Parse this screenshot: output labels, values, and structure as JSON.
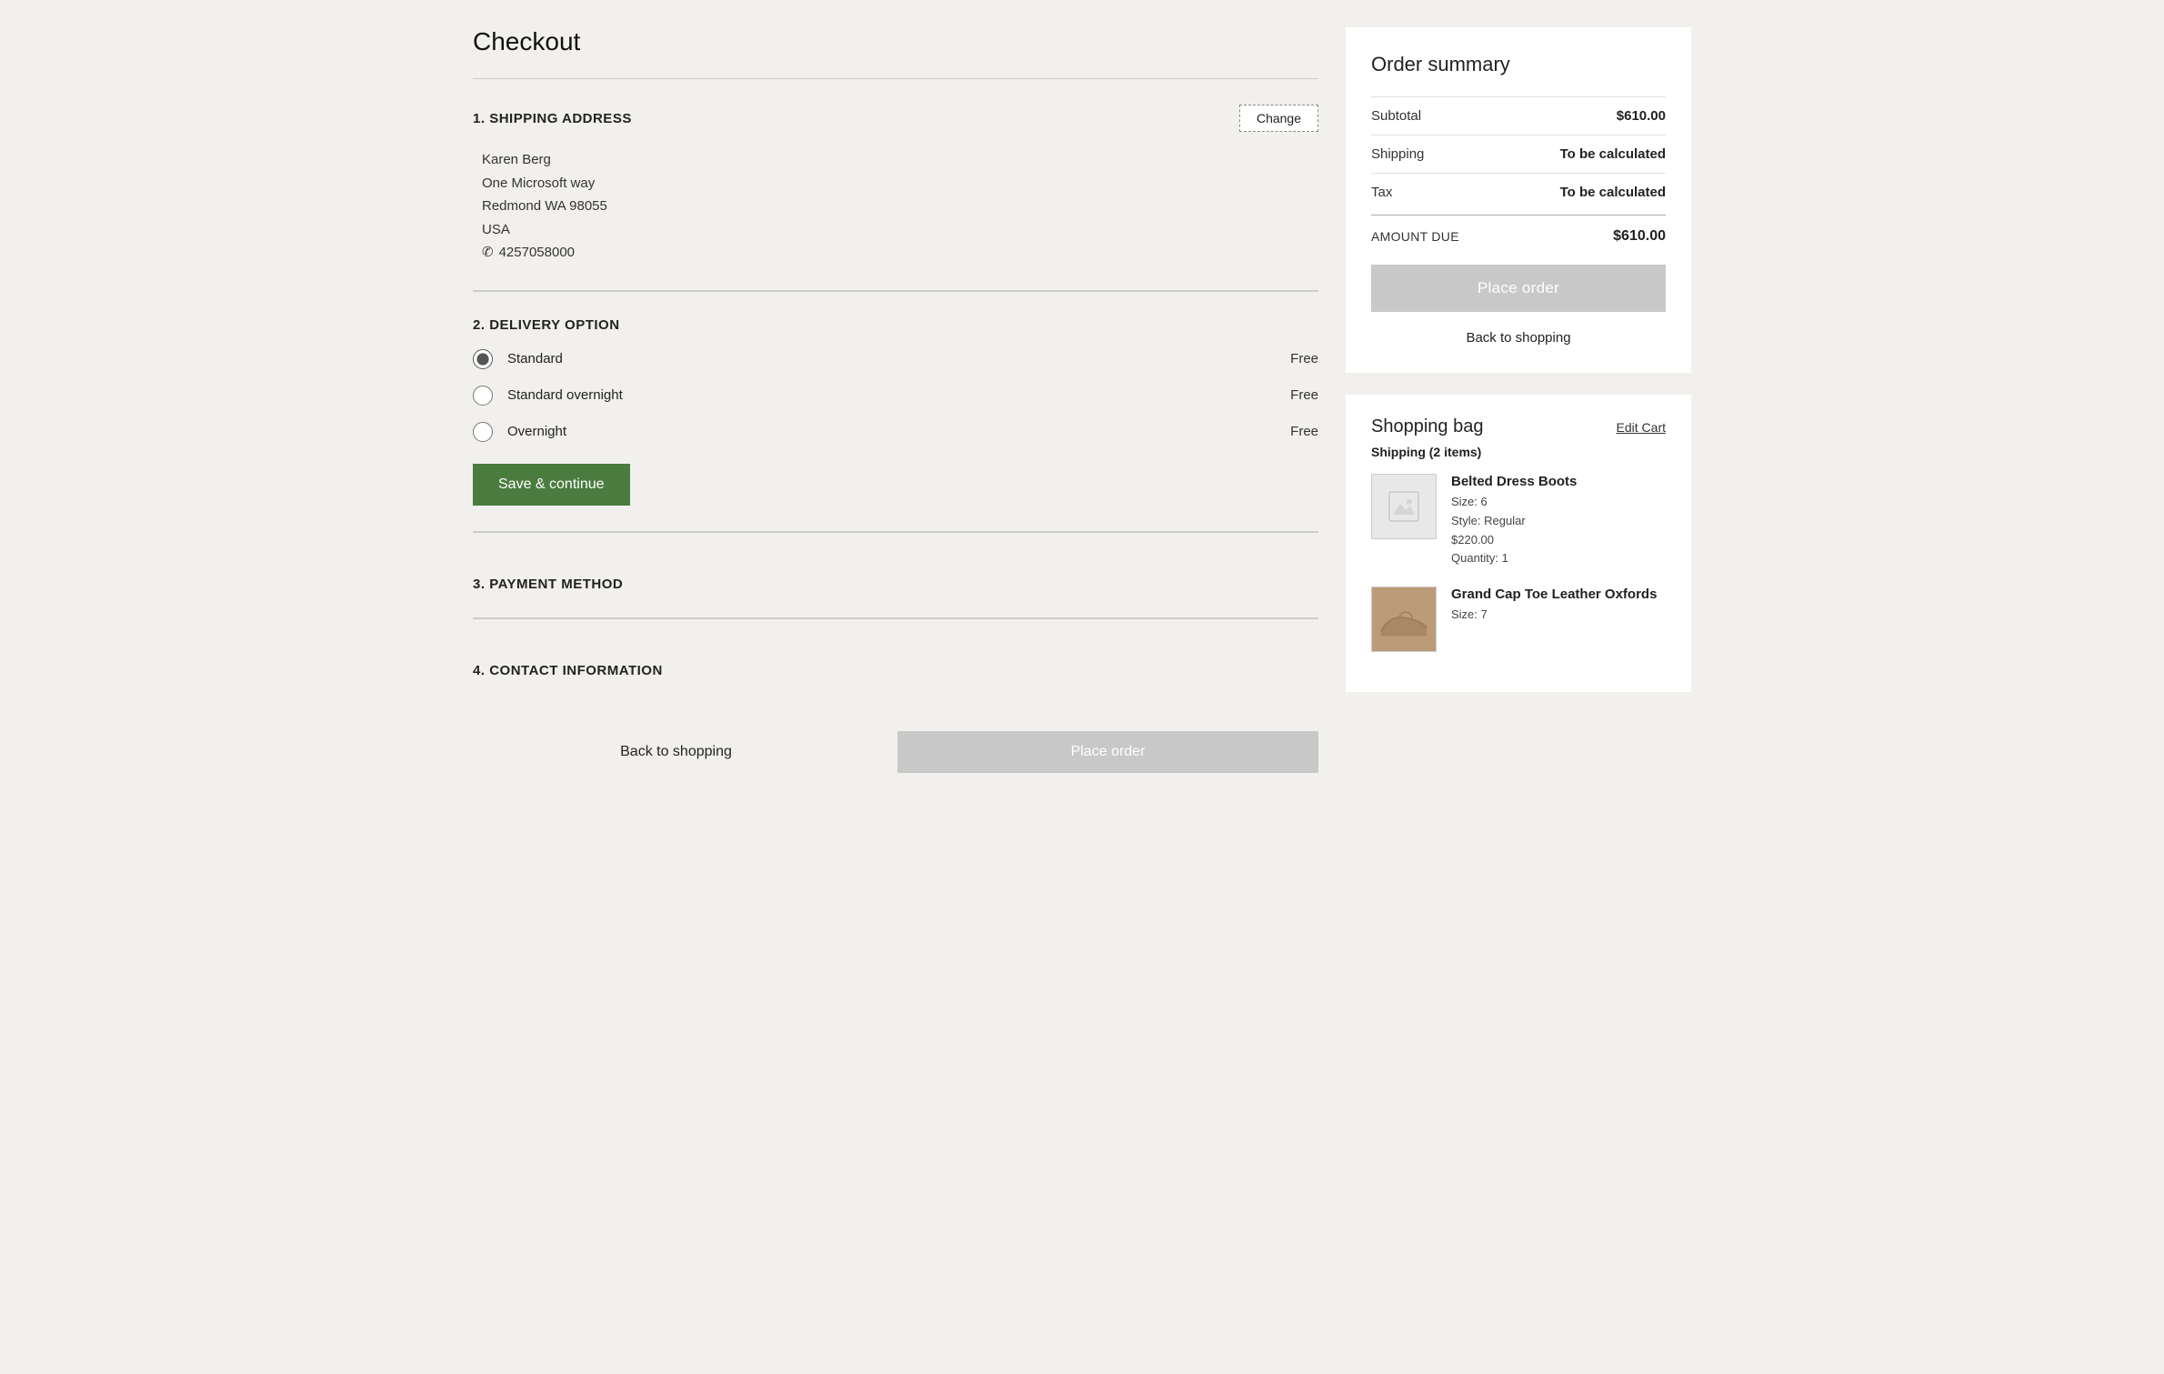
{
  "page": {
    "title": "Checkout"
  },
  "sections": {
    "shipping": {
      "number": "1.",
      "title": "SHIPPING ADDRESS",
      "change_btn": "Change",
      "address": {
        "name": "Karen Berg",
        "street": "One Microsoft way",
        "city_state_zip": "Redmond WA  98055",
        "country": "USA",
        "phone": "4257058000",
        "phone_icon": "☎"
      }
    },
    "delivery": {
      "number": "2.",
      "title": "DELIVERY OPTION",
      "options": [
        {
          "id": "standard",
          "label": "Standard",
          "price": "Free",
          "checked": true
        },
        {
          "id": "standard-overnight",
          "label": "Standard overnight",
          "price": "Free",
          "checked": false
        },
        {
          "id": "overnight",
          "label": "Overnight",
          "price": "Free",
          "checked": false
        }
      ],
      "save_btn": "Save & continue"
    },
    "payment": {
      "number": "3.",
      "title": "PAYMENT METHOD"
    },
    "contact": {
      "number": "4.",
      "title": "CONTACT INFORMATION"
    }
  },
  "bottom_actions": {
    "back_label": "Back to shopping",
    "place_order_label": "Place order"
  },
  "order_summary": {
    "title": "Order summary",
    "subtotal_label": "Subtotal",
    "subtotal_value": "$610.00",
    "shipping_label": "Shipping",
    "shipping_value": "To be calculated",
    "tax_label": "Tax",
    "tax_value": "To be calculated",
    "amount_due_label": "AMOUNT DUE",
    "amount_due_value": "$610.00",
    "place_order_btn": "Place order",
    "back_to_shopping": "Back to shopping"
  },
  "shopping_bag": {
    "title": "Shopping bag",
    "edit_cart": "Edit Cart",
    "shipping_items_label": "Shipping (2 items)",
    "items": [
      {
        "name": "Belted Dress Boots",
        "size": "6",
        "style": "Regular",
        "price": "$220.00",
        "quantity": "1",
        "has_image": false
      },
      {
        "name": "Grand Cap Toe Leather Oxfords",
        "size": "7",
        "has_image": true
      }
    ]
  }
}
